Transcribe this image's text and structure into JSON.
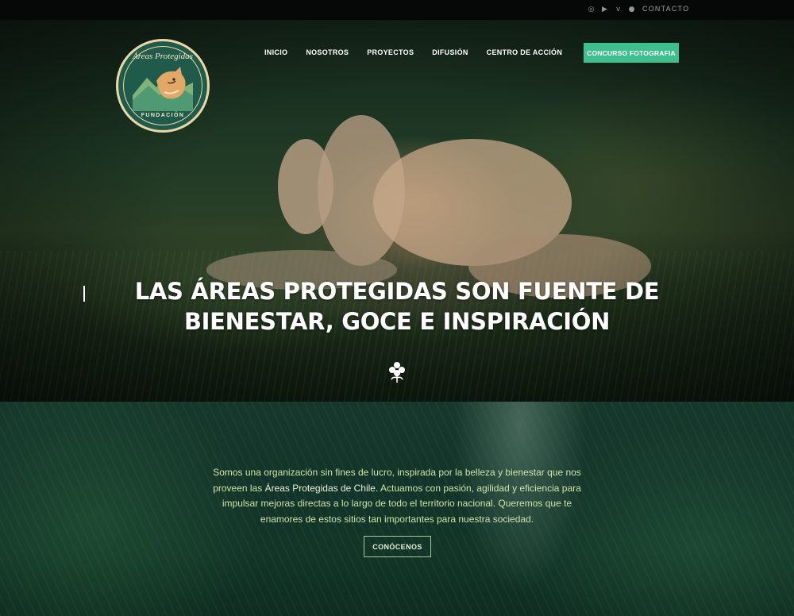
{
  "topbar": {
    "social_icons": [
      "instagram-icon",
      "youtube-icon",
      "vimeo-icon",
      "spotify-icon"
    ],
    "contact_label": "CONTACTO"
  },
  "logo": {
    "top_text": "Áreas Protegidas",
    "bottom_text": "FUNDACIÓN"
  },
  "nav": {
    "items": [
      {
        "label": "INICIO"
      },
      {
        "label": "NOSOTROS"
      },
      {
        "label": "PROYECTOS"
      },
      {
        "label": "DIFUSIÓN"
      },
      {
        "label": "CENTRO DE ACCIÓN"
      }
    ],
    "cta_label": "CONCURSO FOTOGRAFIA"
  },
  "hero": {
    "title_line1": "LAS ÁREAS PROTEGIDAS SON FUENTE DE",
    "title_line2": "BIENESTAR, GOCE E INSPIRACIÓN",
    "scroll_icon": "flower-emblem-icon"
  },
  "about": {
    "text_part1": "Somos una organización sin fines de lucro, inspirada por la belleza y bienestar que nos proveen las ",
    "text_highlight": "Áreas Protegidas de Chile.",
    "text_part2": " Actuamos con pasión, agilidad y eficiencia para impulsar mejoras directas a lo largo de todo el territorio nacional. Queremos que te enamores de estos sitios tan importantes para nuestra sociedad.",
    "button_label": "CONÓCENOS"
  },
  "colors": {
    "accent": "#3fbf8e",
    "logo_green": "#1f5a4a",
    "about_text": "#cfe3a8"
  }
}
